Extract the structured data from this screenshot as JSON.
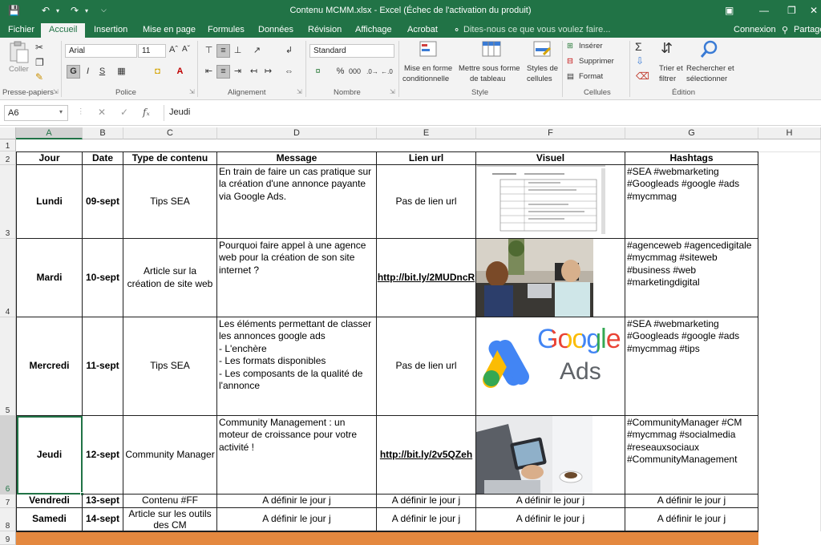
{
  "window": {
    "title": "Contenu MCMM.xlsx - Excel (Échec de l'activation du produit)"
  },
  "ribbon_tabs": [
    "Fichier",
    "Accueil",
    "Insertion",
    "Mise en page",
    "Formules",
    "Données",
    "Révision",
    "Affichage",
    "Acrobat"
  ],
  "tell_me": "Dites-nous ce que vous voulez faire...",
  "account": {
    "signin": "Connexion",
    "share": "Partage"
  },
  "ribbon": {
    "paste": "Coller",
    "font_name": "Arial",
    "font_size": "11",
    "number_format": "Standard",
    "conditional_format": [
      "Mise en forme",
      "conditionnelle"
    ],
    "format_table": [
      "Mettre sous forme",
      "de tableau"
    ],
    "cell_styles": [
      "Styles de",
      "cellules"
    ],
    "insert": "Insérer",
    "delete": "Supprimer",
    "format": "Format",
    "sort_filter": [
      "Trier et",
      "filtrer"
    ],
    "find_select": [
      "Rechercher et",
      "sélectionner"
    ],
    "groups": {
      "clipboard": "Presse-papiers",
      "font": "Police",
      "alignment": "Alignement",
      "number": "Nombre",
      "styles": "Style",
      "cells": "Cellules",
      "editing": "Édition"
    }
  },
  "formula_bar": {
    "name_box": "A6",
    "content": "Jeudi"
  },
  "columns": [
    "A",
    "B",
    "C",
    "D",
    "E",
    "F",
    "G",
    "H"
  ],
  "rows": [
    "1",
    "2",
    "3",
    "4",
    "5",
    "6",
    "7",
    "8",
    "9"
  ],
  "headers": [
    "Jour",
    "Date",
    "Type de contenu",
    "Message",
    "Lien url",
    "Visuel",
    "Hashtags"
  ],
  "data_rows": [
    {
      "jour": "Lundi",
      "date": "09-sept",
      "type": "Tips SEA",
      "message": "En train de faire un cas pratique sur la création d'une annonce payante via Google Ads.",
      "lien": "Pas de lien url",
      "hashtags": "#SEA #webmarketing #Googleads #google #ads #mycmmag"
    },
    {
      "jour": "Mardi",
      "date": "10-sept",
      "type": "Article sur la création de site web",
      "message": "Pourquoi faire appel à une agence web pour la création de son site internet ?",
      "lien": "http://bit.ly/2MUDncR",
      "hashtags": "#agenceweb #agencedigitale #mycmmag #siteweb #business #web #marketingdigital"
    },
    {
      "jour": "Mercredi",
      "date": "11-sept",
      "type": "Tips SEA",
      "message": "Les éléments permettant de classer les annonces google ads\n- L'enchère\n- Les formats disponibles\n- Les composants de la qualité de l'annonce",
      "lien": "Pas de lien url",
      "hashtags": "#SEA #webmarketing #Googleads #google #ads #mycmmag #tips"
    },
    {
      "jour": "Jeudi",
      "date": "12-sept",
      "type": "Community Manager",
      "message": "Community Management : un moteur de croissance pour votre activité !",
      "lien": "http://bit.ly/2v5QZeh",
      "hashtags": "#CommunityManager #CM #mycmmag #socialmedia #reseauxsociaux #CommunityManagement"
    },
    {
      "jour": "Vendredi",
      "date": "13-sept",
      "type": "Contenu #FF",
      "message": "A définir le jour j",
      "lien": "A définir le jour j",
      "visuel": "A définir le jour j",
      "hashtags": "A définir le jour j"
    },
    {
      "jour": "Samedi",
      "date": "14-sept",
      "type": "Article sur les outils des CM",
      "message": "A définir le jour j",
      "lien": "A définir le jour j",
      "visuel": "A définir le jour j",
      "hashtags": "A définir le jour j"
    }
  ],
  "visuals": {
    "google_ads_logo": {
      "word1": "Google",
      "word2": "Ads"
    }
  },
  "colors": {
    "excel_green": "#217346",
    "orange_row": "#e4883f",
    "google_blue": "#4285f4",
    "google_yellow": "#fbbc04",
    "google_green": "#34a853",
    "google_red": "#ea4335"
  }
}
